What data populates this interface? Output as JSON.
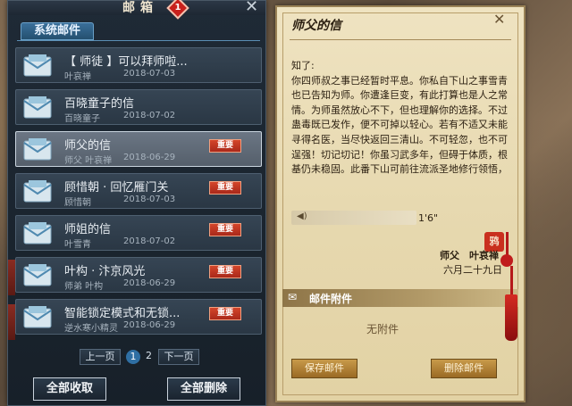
{
  "mailbox": {
    "title": "邮箱",
    "unread_count": "1",
    "close": "✕",
    "tab": "系统邮件",
    "mails": [
      {
        "subject": "【 师徒 】可以拜师啦...",
        "sender": "叶哀禅",
        "date": "2018-07-03",
        "badge": "",
        "selected": false
      },
      {
        "subject": "百晓童子的信",
        "sender": "百晓童子",
        "date": "2018-07-02",
        "badge": "",
        "selected": false
      },
      {
        "subject": "师父的信",
        "sender": "师父 叶哀禅",
        "date": "2018-06-29",
        "badge": "重要",
        "selected": true
      },
      {
        "subject": "顾惜朝 · 回忆雁门关",
        "sender": "顾惜朝",
        "date": "2018-07-03",
        "badge": "重要",
        "selected": false
      },
      {
        "subject": "师姐的信",
        "sender": "叶雪青",
        "date": "2018-07-02",
        "badge": "重要",
        "selected": false
      },
      {
        "subject": "叶构 · 汴京风光",
        "sender": "师弟 叶构",
        "date": "2018-06-29",
        "badge": "重要",
        "selected": false
      },
      {
        "subject": "智能锁定模式和无锁...",
        "sender": "逆水寒小精灵",
        "date": "2018-06-29",
        "badge": "重要",
        "selected": false
      }
    ],
    "pager": {
      "prev": "上一页",
      "page1": "1",
      "page2": "2",
      "next": "下一页"
    },
    "collect_all": "全部收取",
    "delete_all": "全部删除"
  },
  "letter": {
    "title": "师父的信",
    "close": "✕",
    "greeting": "知了:",
    "body": "你四师叔之事已经暂时平息。你私自下山之事雪青也已告知为师。你遭逢巨变，有此打算也是人之常情。为师虽然放心不下，但也理解你的选择。不过蛊毒既已发作，便不可掉以轻心。若有不适又未能寻得名医，当尽快返回三清山。不可轻忽，也不可逞强！切记切记！你虽习武多年，但碍于体质，根基仍未稳固。此番下山可前往流派圣地修行领悟，",
    "voice_length": "1'6\"",
    "seal": "鸦",
    "sign_name": "师父　叶哀禅",
    "sign_date": "六月二十九日",
    "attach_label": "邮件附件",
    "attach_empty": "无附件",
    "save_button": "保存邮件",
    "delete_button": "删除邮件"
  },
  "colors": {
    "badge": "#c0321e",
    "selected_border": "#c9d4de",
    "tab": "#2f6fa3"
  },
  "icons": {
    "mail": "envelope-icon",
    "voice": "speaker-icon",
    "attach": "paperclip-icon"
  }
}
